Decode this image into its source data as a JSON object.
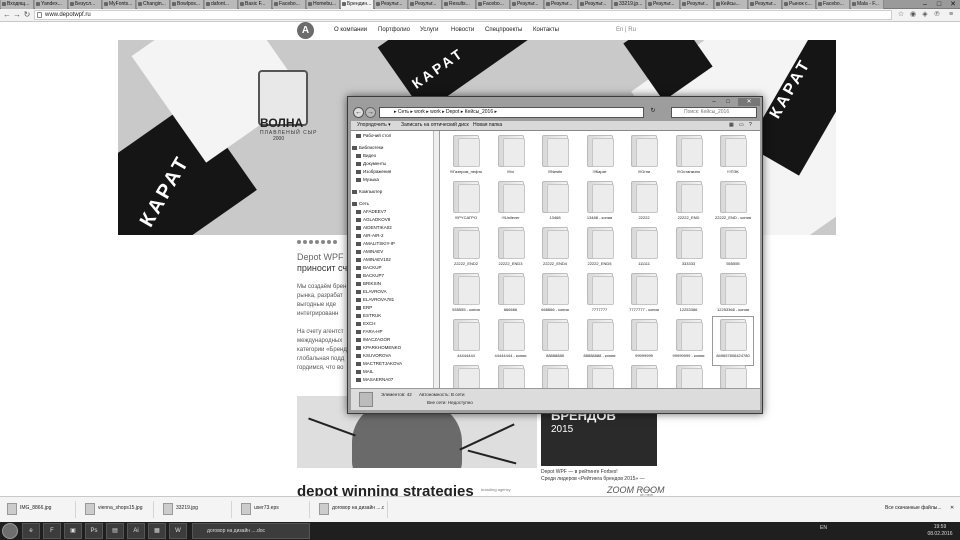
{
  "browser": {
    "tabs": [
      "Входящ...",
      "Yandex...",
      "Безусл...",
      "MyFonts...",
      "Changin...",
      "Bowlpos...",
      "dafont...",
      "Basic F...",
      "Facebo...",
      "Homebu...",
      "Брендин...",
      "Результ...",
      "Результ...",
      "Results...",
      "Facebo...",
      "Результ...",
      "Результ...",
      "Результ...",
      "33219.jp...",
      "Результ...",
      "Результ...",
      "Кейсы...",
      "Результ...",
      "Рынок с...",
      "Facebo...",
      "Mala - F..."
    ],
    "active_tab_index": 10,
    "url": "www.depotwpf.ru"
  },
  "site": {
    "logo_letter": "A",
    "nav": [
      "О компании",
      "Портфолио",
      "Услуги",
      "Новости",
      "Спецпроекты",
      "Контакты"
    ],
    "lang": "En | Ru",
    "hero": {
      "brand_word": "КАРАТ",
      "product_name": "ВОЛНА",
      "product_sub": "ПЛАВЛЕНЫЙ СЫР",
      "product_year": "2000"
    },
    "heading_line1": "Depot WPF",
    "heading_line2": "приносит сч",
    "para1": [
      "Мы создаём брен",
      "рынка, разрабат",
      "выгодные иде",
      "интегрированн"
    ],
    "para2": [
      "На счету агентст",
      "международных",
      "категории «Бренд",
      "глобальная подд",
      "гордимся, что во"
    ],
    "news_big": "БРЕНДОВ",
    "news_year": "2015",
    "news_caption": [
      "Depot WPF — в рейтинге Forbes!",
      "Среди лидеров «Рейтинга брендов 2015» —"
    ],
    "footer_logo": "depot winning strategies",
    "footer_sub": "branding agency",
    "zoom_logo": "ZOOM ROOM",
    "zoom_sub": [
      "Focus",
      "on new",
      "brands"
    ]
  },
  "explorer": {
    "breadcrumbs": "▸ Сеть ▸ work ▸ work ▸ Depot ▸ Кейсы_2016 ▸",
    "search_placeholder": "Поиск: Кейсы_2016",
    "toolbar": [
      "Упорядочить ▾",
      "Записать на оптический диск",
      "Новая папка"
    ],
    "nav": [
      {
        "label": "Рабочий стол",
        "kind": "item"
      },
      {
        "label": "Библиотеки",
        "kind": "group"
      },
      {
        "label": "Видео",
        "kind": "item"
      },
      {
        "label": "Документы",
        "kind": "item"
      },
      {
        "label": "Изображения",
        "kind": "item"
      },
      {
        "label": "Музыка",
        "kind": "item"
      },
      {
        "label": "Компьютер",
        "kind": "group"
      },
      {
        "label": "Сеть",
        "kind": "group"
      },
      {
        "label": "AFADEEV7",
        "kind": "item"
      },
      {
        "label": "AGLADKOV8",
        "kind": "item"
      },
      {
        "label": "AIDENTIKA02",
        "kind": "item"
      },
      {
        "label": "AIR-AIR-2",
        "kind": "item"
      },
      {
        "label": "AMALITSKIY-IP",
        "kind": "item"
      },
      {
        "label": "AMINAEV",
        "kind": "item"
      },
      {
        "label": "AMINAEV102",
        "kind": "item"
      },
      {
        "label": "BACKUP",
        "kind": "item"
      },
      {
        "label": "BACKUP7",
        "kind": "item"
      },
      {
        "label": "BRIKSIN",
        "kind": "item"
      },
      {
        "label": "ELAVROVA",
        "kind": "item"
      },
      {
        "label": "ELAVROVA781",
        "kind": "item"
      },
      {
        "label": "ERP",
        "kind": "item"
      },
      {
        "label": "ESTRUK",
        "kind": "item"
      },
      {
        "label": "EXCH",
        "kind": "item"
      },
      {
        "label": "FARA-HP",
        "kind": "item"
      },
      {
        "label": "IMACZAGOR",
        "kind": "item"
      },
      {
        "label": "KPARKHOMENKO",
        "kind": "item"
      },
      {
        "label": "KSUVOROVA",
        "kind": "item"
      },
      {
        "label": "MACTRETJAKOVA",
        "kind": "item"
      },
      {
        "label": "MAIL",
        "kind": "item"
      },
      {
        "label": "MASAERNA07",
        "kind": "item"
      }
    ],
    "folders": [
      "!!!Газпром_нефть",
      "!!!ivi",
      "!!!Nestle",
      "!!!Карат",
      "!!!Огни",
      "!!!Останкино",
      "!!!ПЭК",
      "!!!PYCAГPO",
      "!!!Unilever",
      "13468",
      "13488 - копия",
      "22222",
      "22222_END",
      "22222_END - копия",
      "22222_END2",
      "22222_END3",
      "22222_END4",
      "22222_END5",
      "111111",
      "333333",
      "555555",
      "555555 - копия",
      "666666",
      "666666 - копия",
      "7777777",
      "7777777 - копия",
      "12253366",
      "12253366 - копия",
      "44444444",
      "44444444 - копия",
      "88888888",
      "88888888 - копия",
      "99999999",
      "99999999 - копия",
      "849657806424780",
      "",
      "",
      "",
      "",
      "",
      "",
      ""
    ],
    "status_count": "Элементов: 42",
    "status_offline": "Автономность: В сети",
    "status_offline2": "Вне сети: Недоступно"
  },
  "downloads": {
    "items": [
      "IMG_8866.jpg",
      "vienna_shops15.jpg",
      "33219.jpg",
      "user73.eps",
      "договор на дизайн ....doc"
    ],
    "show_all": "Все скачанные файлы..."
  },
  "taskbar": {
    "apps": [
      "e",
      "F",
      "▣",
      "Ps",
      "▤",
      "Ai",
      "▦",
      "W"
    ],
    "lang": "EN",
    "time": "19:59",
    "date": "08.02.2016"
  }
}
